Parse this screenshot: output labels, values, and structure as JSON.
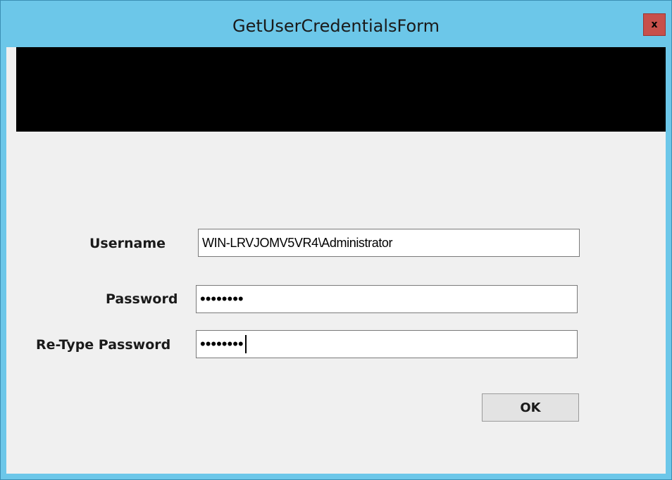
{
  "window": {
    "title": "GetUserCredentialsForm",
    "close_label": "x"
  },
  "form": {
    "username_label": "Username",
    "username_value": "WIN-LRVJOMV5VR4\\Administrator",
    "password_label": "Password",
    "password_value": "••••••••",
    "retype_label": "Re-Type Password",
    "retype_value": "••••••••",
    "ok_label": "OK"
  },
  "colors": {
    "frame": "#6cc7e9",
    "close_button": "#c7504b",
    "banner": "#000000",
    "client": "#f0f0f0"
  }
}
